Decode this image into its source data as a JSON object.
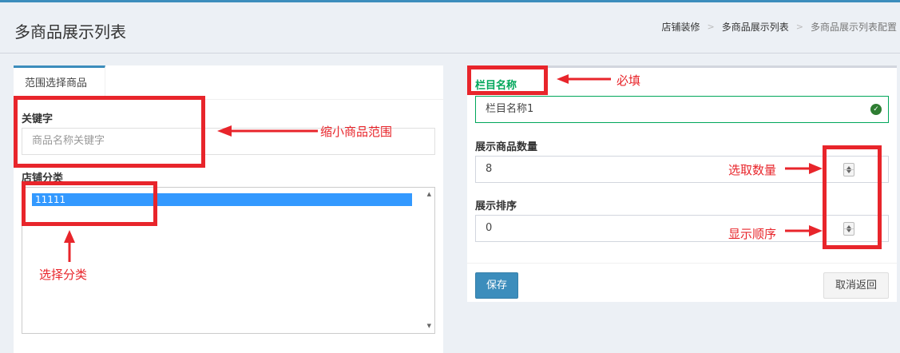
{
  "header": {
    "title": "多商品展示列表",
    "breadcrumb": [
      "店铺装修",
      "多商品展示列表",
      "多商品展示列表配置"
    ],
    "breadcrumb_sep": ">"
  },
  "left_panel": {
    "tab_label": "范围选择商品",
    "keyword_label": "关键字",
    "keyword_placeholder": "商品名称关键字",
    "category_label": "店铺分类",
    "category_options": [
      "11111"
    ]
  },
  "right_panel": {
    "column_name_label": "栏目名称",
    "column_name_value": "栏目名称1",
    "qty_label": "展示商品数量",
    "qty_value": "8",
    "order_label": "展示排序",
    "order_value": "0",
    "save_label": "保存",
    "cancel_label": "取消返回"
  },
  "annotations": {
    "required": "必填",
    "narrow_range": "缩小商品范围",
    "select_category": "选择分类",
    "select_qty": "选取数量",
    "display_order": "显示顺序"
  },
  "colors": {
    "primary": "#3c8dbc",
    "success": "#00a65a",
    "annotation_red": "#e8252b",
    "selected_option": "#3399ff"
  }
}
